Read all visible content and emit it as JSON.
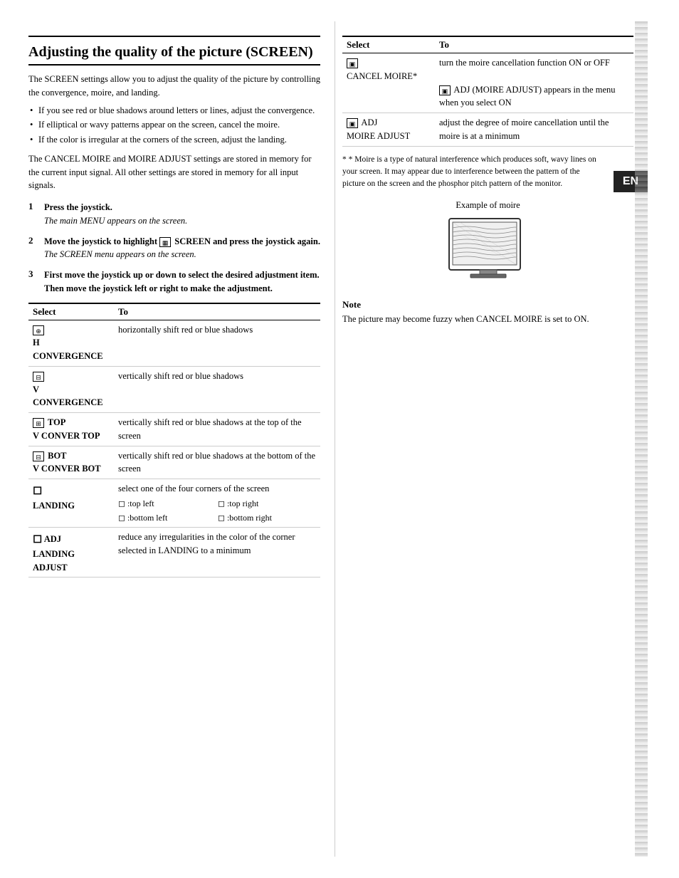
{
  "page": {
    "title": "Adjusting the quality of the picture (SCREEN)",
    "left": {
      "intro": "The SCREEN settings allow you to adjust the quality of the picture by controlling the convergence, moire, and landing.",
      "bullets": [
        "If you see red or blue shadows around letters or lines, adjust the convergence.",
        "If elliptical or wavy patterns appear on the screen, cancel the moire.",
        "If the color is irregular at the corners of the screen, adjust the landing."
      ],
      "stored_text": "The CANCEL MOIRE and MOIRE ADJUST settings are stored in memory for the current input signal. All other settings are stored in memory for all input signals.",
      "steps": [
        {
          "num": "1",
          "bold": "Press the joystick.",
          "sub": "The main MENU appears on the screen."
        },
        {
          "num": "2",
          "bold": "Move the joystick to highlight   SCREEN and press the joystick again.",
          "sub": "The SCREEN menu appears on the screen."
        },
        {
          "num": "3",
          "bold": "First move the joystick up or down to select the desired adjustment item. Then move the joystick left or right to make the adjustment.",
          "sub": ""
        }
      ],
      "table": {
        "headers": [
          "Select",
          "To"
        ],
        "rows": [
          {
            "select_icon": "⊕",
            "select_label": "H CONVERGENCE",
            "to": "horizontally shift red or blue shadows"
          },
          {
            "select_icon": "⊟",
            "select_label": "V CONVERGENCE",
            "to": "vertically shift red or blue shadows"
          },
          {
            "select_icon": "⊞",
            "select_label": "TOP\nV CONVER TOP",
            "to": "vertically shift red or blue shadows at the top of the screen"
          },
          {
            "select_icon": "⊟",
            "select_label": "BOT\nV CONVER BOT",
            "to": "vertically shift red or blue shadows at the bottom of the screen"
          },
          {
            "select_icon": "◻",
            "select_label": "LANDING",
            "to": "select one of the four corners of the screen",
            "corners": [
              "◻:top left",
              "◻:top right",
              "◻:bottom left",
              "◻:bottom right"
            ]
          },
          {
            "select_icon": "◻",
            "select_label": "ADJ\nLANDING ADJUST",
            "to": "reduce any irregularities in the color of the corner selected in LANDING to a minimum"
          }
        ]
      }
    },
    "right": {
      "table": {
        "headers": [
          "Select",
          "To"
        ],
        "rows": [
          {
            "select_icon": "▣",
            "select_label": "CANCEL MOIRE*",
            "to_parts": [
              "turn the moire cancellation function ON or OFF",
              "  ADJ (MOIRE ADJUST) appears in the menu when you select ON"
            ]
          },
          {
            "select_icon": "▣",
            "select_label": "ADJ\nMOIRE ADJUST",
            "to_parts": [
              "adjust the degree of moire cancellation until the moire is at a minimum"
            ]
          }
        ]
      },
      "footnote": "* Moire is a type of natural interference which produces soft, wavy lines on your screen. It may appear due to interference between the pattern of the picture on the screen and the phosphor pitch pattern of the monitor.",
      "example_label": "Example of moire",
      "note_title": "Note",
      "note_text": "The picture may become fuzzy when CANCEL MOIRE is set to ON.",
      "en_badge": "EN"
    }
  }
}
